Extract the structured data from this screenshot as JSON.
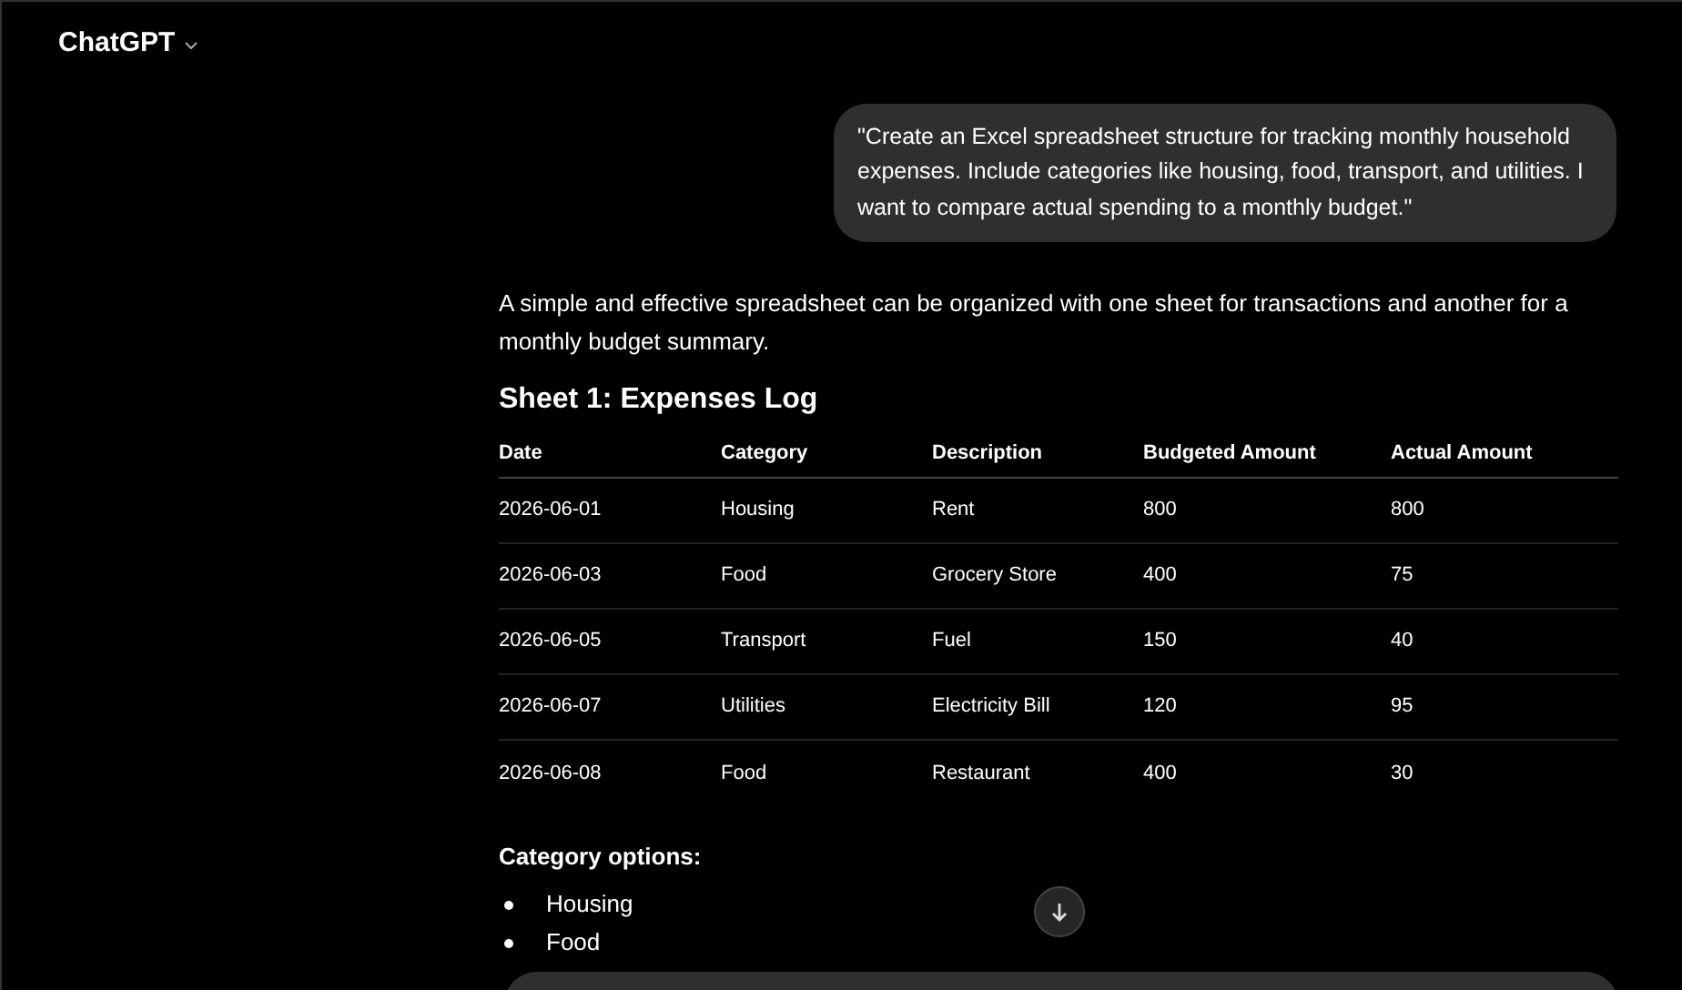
{
  "header": {
    "title": "ChatGPT"
  },
  "user_message": "\"Create an Excel spreadsheet structure for tracking monthly household expenses. Include categories like housing, food, transport, and utilities. I want to compare actual spending to a monthly budget.\"",
  "response": {
    "intro": "A simple and effective spreadsheet can be organized with one sheet for transactions and another for a monthly budget summary.",
    "heading": "Sheet 1: Expenses Log",
    "table": {
      "columns": [
        "Date",
        "Category",
        "Description",
        "Budgeted Amount",
        "Actual Amount"
      ],
      "rows": [
        [
          "2026-06-01",
          "Housing",
          "Rent",
          "800",
          "800"
        ],
        [
          "2026-06-03",
          "Food",
          "Grocery Store",
          "400",
          "75"
        ],
        [
          "2026-06-05",
          "Transport",
          "Fuel",
          "150",
          "40"
        ],
        [
          "2026-06-07",
          "Utilities",
          "Electricity Bill",
          "120",
          "95"
        ],
        [
          "2026-06-08",
          "Food",
          "Restaurant",
          "400",
          "30"
        ]
      ]
    },
    "list_heading": "Category options:",
    "list_items": [
      "Housing",
      "Food"
    ]
  }
}
